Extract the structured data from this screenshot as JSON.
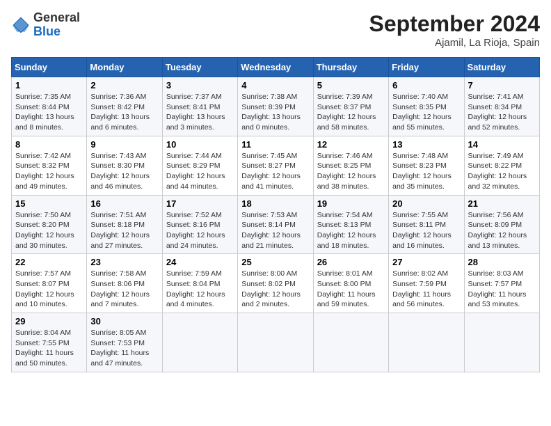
{
  "header": {
    "logo_general": "General",
    "logo_blue": "Blue",
    "month": "September 2024",
    "location": "Ajamil, La Rioja, Spain"
  },
  "weekdays": [
    "Sunday",
    "Monday",
    "Tuesday",
    "Wednesday",
    "Thursday",
    "Friday",
    "Saturday"
  ],
  "weeks": [
    [
      {
        "day": "1",
        "sunrise": "7:35 AM",
        "sunset": "8:44 PM",
        "daylight": "13 hours and 8 minutes."
      },
      {
        "day": "2",
        "sunrise": "7:36 AM",
        "sunset": "8:42 PM",
        "daylight": "13 hours and 6 minutes."
      },
      {
        "day": "3",
        "sunrise": "7:37 AM",
        "sunset": "8:41 PM",
        "daylight": "13 hours and 3 minutes."
      },
      {
        "day": "4",
        "sunrise": "7:38 AM",
        "sunset": "8:39 PM",
        "daylight": "13 hours and 0 minutes."
      },
      {
        "day": "5",
        "sunrise": "7:39 AM",
        "sunset": "8:37 PM",
        "daylight": "12 hours and 58 minutes."
      },
      {
        "day": "6",
        "sunrise": "7:40 AM",
        "sunset": "8:35 PM",
        "daylight": "12 hours and 55 minutes."
      },
      {
        "day": "7",
        "sunrise": "7:41 AM",
        "sunset": "8:34 PM",
        "daylight": "12 hours and 52 minutes."
      }
    ],
    [
      {
        "day": "8",
        "sunrise": "7:42 AM",
        "sunset": "8:32 PM",
        "daylight": "12 hours and 49 minutes."
      },
      {
        "day": "9",
        "sunrise": "7:43 AM",
        "sunset": "8:30 PM",
        "daylight": "12 hours and 46 minutes."
      },
      {
        "day": "10",
        "sunrise": "7:44 AM",
        "sunset": "8:29 PM",
        "daylight": "12 hours and 44 minutes."
      },
      {
        "day": "11",
        "sunrise": "7:45 AM",
        "sunset": "8:27 PM",
        "daylight": "12 hours and 41 minutes."
      },
      {
        "day": "12",
        "sunrise": "7:46 AM",
        "sunset": "8:25 PM",
        "daylight": "12 hours and 38 minutes."
      },
      {
        "day": "13",
        "sunrise": "7:48 AM",
        "sunset": "8:23 PM",
        "daylight": "12 hours and 35 minutes."
      },
      {
        "day": "14",
        "sunrise": "7:49 AM",
        "sunset": "8:22 PM",
        "daylight": "12 hours and 32 minutes."
      }
    ],
    [
      {
        "day": "15",
        "sunrise": "7:50 AM",
        "sunset": "8:20 PM",
        "daylight": "12 hours and 30 minutes."
      },
      {
        "day": "16",
        "sunrise": "7:51 AM",
        "sunset": "8:18 PM",
        "daylight": "12 hours and 27 minutes."
      },
      {
        "day": "17",
        "sunrise": "7:52 AM",
        "sunset": "8:16 PM",
        "daylight": "12 hours and 24 minutes."
      },
      {
        "day": "18",
        "sunrise": "7:53 AM",
        "sunset": "8:14 PM",
        "daylight": "12 hours and 21 minutes."
      },
      {
        "day": "19",
        "sunrise": "7:54 AM",
        "sunset": "8:13 PM",
        "daylight": "12 hours and 18 minutes."
      },
      {
        "day": "20",
        "sunrise": "7:55 AM",
        "sunset": "8:11 PM",
        "daylight": "12 hours and 16 minutes."
      },
      {
        "day": "21",
        "sunrise": "7:56 AM",
        "sunset": "8:09 PM",
        "daylight": "12 hours and 13 minutes."
      }
    ],
    [
      {
        "day": "22",
        "sunrise": "7:57 AM",
        "sunset": "8:07 PM",
        "daylight": "12 hours and 10 minutes."
      },
      {
        "day": "23",
        "sunrise": "7:58 AM",
        "sunset": "8:06 PM",
        "daylight": "12 hours and 7 minutes."
      },
      {
        "day": "24",
        "sunrise": "7:59 AM",
        "sunset": "8:04 PM",
        "daylight": "12 hours and 4 minutes."
      },
      {
        "day": "25",
        "sunrise": "8:00 AM",
        "sunset": "8:02 PM",
        "daylight": "12 hours and 2 minutes."
      },
      {
        "day": "26",
        "sunrise": "8:01 AM",
        "sunset": "8:00 PM",
        "daylight": "11 hours and 59 minutes."
      },
      {
        "day": "27",
        "sunrise": "8:02 AM",
        "sunset": "7:59 PM",
        "daylight": "11 hours and 56 minutes."
      },
      {
        "day": "28",
        "sunrise": "8:03 AM",
        "sunset": "7:57 PM",
        "daylight": "11 hours and 53 minutes."
      }
    ],
    [
      {
        "day": "29",
        "sunrise": "8:04 AM",
        "sunset": "7:55 PM",
        "daylight": "11 hours and 50 minutes."
      },
      {
        "day": "30",
        "sunrise": "8:05 AM",
        "sunset": "7:53 PM",
        "daylight": "11 hours and 47 minutes."
      },
      null,
      null,
      null,
      null,
      null
    ]
  ]
}
